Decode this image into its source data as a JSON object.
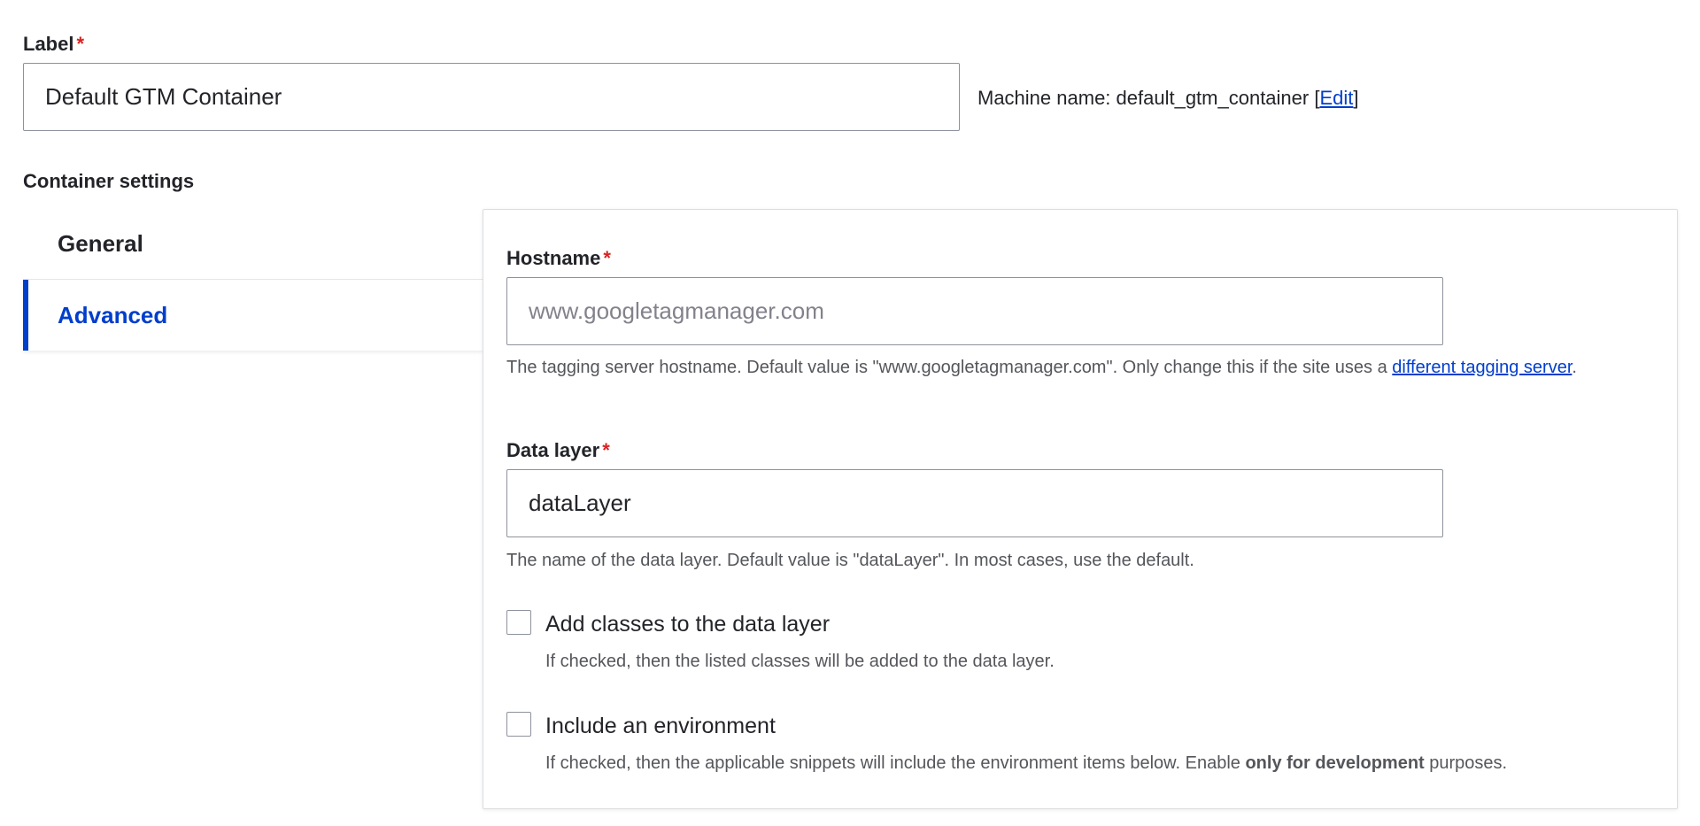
{
  "label_field": {
    "label": "Label",
    "required_mark": "*",
    "value": "Default GTM Container",
    "machine_name_prefix": "Machine name: default_gtm_container [",
    "machine_name_edit_link": "Edit",
    "machine_name_suffix": "]"
  },
  "container_settings": {
    "title": "Container settings",
    "tabs": [
      {
        "label": "General",
        "active": false
      },
      {
        "label": "Advanced",
        "active": true
      }
    ]
  },
  "advanced": {
    "hostname": {
      "label": "Hostname",
      "required_mark": "*",
      "placeholder": "www.googletagmanager.com",
      "value": "",
      "description_text": "The tagging server hostname. Default value is \"www.googletagmanager.com\". Only change this if the site uses a ",
      "description_link": "different tagging server",
      "description_end": "."
    },
    "data_layer": {
      "label": "Data layer",
      "required_mark": "*",
      "value": "dataLayer",
      "description": "The name of the data layer. Default value is \"dataLayer\". In most cases, use the default."
    },
    "add_classes": {
      "label": "Add classes to the data layer",
      "checked": false,
      "description": "If checked, then the listed classes will be added to the data layer."
    },
    "include_environment": {
      "label": "Include an environment",
      "checked": false,
      "description_prefix": "If checked, then the applicable snippets will include the environment items below. Enable ",
      "description_bold": "only for development",
      "description_suffix": " purposes."
    }
  },
  "colors": {
    "link": "#003ecc",
    "required": "#d72222",
    "text": "#232429",
    "description": "#55565b",
    "border": "#8e929c"
  }
}
